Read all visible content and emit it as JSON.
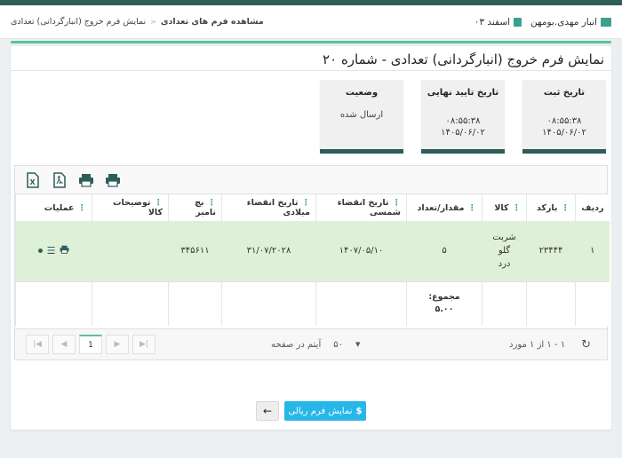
{
  "header": {
    "store_label": "انبار مهدی.بومهن",
    "date_label": "اسفند ۰۳",
    "breadcrumb": [
      "مشاهده فرم های تعدادی",
      "نمایش فرم خروج (انبارگردانی) تعدادی"
    ]
  },
  "page_title": "نمایش فرم خروج (انبارگردانی) تعدادی - شماره ۲۰",
  "cards": [
    {
      "title": "تاریخ ثبت",
      "line1": "۰۸:۵۵:۳۸",
      "line2": "۱۴۰۵/۰۶/۰۲"
    },
    {
      "title": "تاریخ تایید نهایی",
      "line1": "۰۸:۵۵:۳۸",
      "line2": "۱۴۰۵/۰۶/۰۲"
    },
    {
      "title": "وضعیت",
      "line1": "ارسال شده"
    }
  ],
  "toolbar": [
    "print-icon",
    "print-icon",
    "pdf-icon",
    "excel-icon"
  ],
  "table": {
    "headers": [
      "ردیف",
      "بارکد",
      "کالا",
      "مقدار/تعداد",
      "تاریخ انقضاء شمسی",
      "تاریخ انقضاء میلادی",
      "بچ نامبر",
      "توضیحات کالا",
      "عملیات"
    ],
    "rows": [
      {
        "index": "۱",
        "barcode": "۲۳۴۴۴",
        "product": "شربت گلو درد",
        "qty": "۵",
        "exp_shamsi": "۱۴۰۷/۰۵/۱۰",
        "exp_miladi": "۳۱/۰۷/۲۰۲۸",
        "batch": "۳۴۵۶۱۱",
        "desc": ""
      }
    ],
    "sum_label": "مجموع:",
    "sum_value": "۵.۰۰"
  },
  "pager": {
    "page": "1",
    "page_size": "۵۰",
    "page_size_label": "آیتم در صفحه",
    "range": "۱ - ۱ از ۱ مورد"
  },
  "buttons": {
    "rial": "نمایش فرم ریالی",
    "back": "←"
  }
}
